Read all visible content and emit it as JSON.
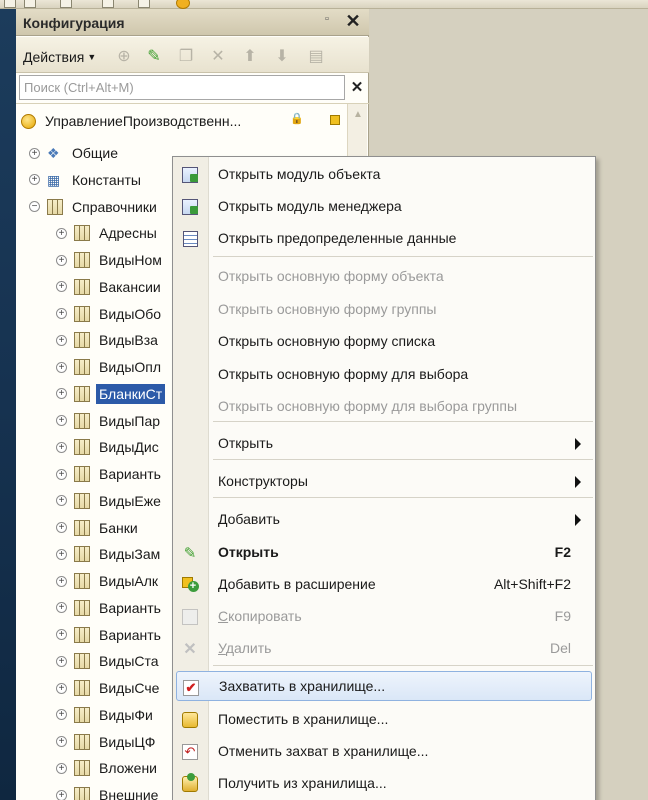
{
  "panel": {
    "title": "Конфигурация",
    "actions_label": "Действия",
    "search_placeholder": "Поиск (Ctrl+Alt+M)"
  },
  "tree": {
    "root": "УправлениеПроизводственн...",
    "items": [
      {
        "label": "Общие",
        "icon": "common-objects-icon",
        "level": 1,
        "expander": "+"
      },
      {
        "label": "Константы",
        "icon": "constants-icon",
        "level": 1,
        "expander": "+"
      },
      {
        "label": "Справочники",
        "icon": "catalog-table-icon",
        "level": 1,
        "expander": "−"
      },
      {
        "label": "Адресны",
        "icon": "catalog-table-icon",
        "level": 2,
        "expander": "+"
      },
      {
        "label": "ВидыНом",
        "icon": "catalog-table-icon",
        "level": 2,
        "expander": "+"
      },
      {
        "label": "Вакансии",
        "icon": "catalog-table-icon",
        "level": 2,
        "expander": "+"
      },
      {
        "label": "ВидыОбо",
        "icon": "catalog-table-icon",
        "level": 2,
        "expander": "+"
      },
      {
        "label": "ВидыВза",
        "icon": "catalog-table-icon",
        "level": 2,
        "expander": "+"
      },
      {
        "label": "ВидыОпл",
        "icon": "catalog-table-icon",
        "level": 2,
        "expander": "+"
      },
      {
        "label": "БланкиСт",
        "icon": "catalog-table-icon",
        "level": 2,
        "expander": "+",
        "selected": true
      },
      {
        "label": "ВидыПар",
        "icon": "catalog-table-icon",
        "level": 2,
        "expander": "+"
      },
      {
        "label": "ВидыДис",
        "icon": "catalog-table-icon",
        "level": 2,
        "expander": "+"
      },
      {
        "label": "Варианть",
        "icon": "catalog-table-icon",
        "level": 2,
        "expander": "+"
      },
      {
        "label": "ВидыЕже",
        "icon": "catalog-table-icon",
        "level": 2,
        "expander": "+"
      },
      {
        "label": "Банки",
        "icon": "catalog-table-icon",
        "level": 2,
        "expander": "+"
      },
      {
        "label": "ВидыЗам",
        "icon": "catalog-table-icon",
        "level": 2,
        "expander": "+"
      },
      {
        "label": "ВидыАлк",
        "icon": "catalog-table-icon",
        "level": 2,
        "expander": "+"
      },
      {
        "label": "Варианть",
        "icon": "catalog-table-icon",
        "level": 2,
        "expander": "+"
      },
      {
        "label": "Варианть",
        "icon": "catalog-table-icon",
        "level": 2,
        "expander": "+"
      },
      {
        "label": "ВидыСта",
        "icon": "catalog-table-icon",
        "level": 2,
        "expander": "+"
      },
      {
        "label": "ВидыСче",
        "icon": "catalog-table-icon",
        "level": 2,
        "expander": "+"
      },
      {
        "label": "ВидыФи",
        "icon": "catalog-table-icon",
        "level": 2,
        "expander": "+"
      },
      {
        "label": "ВидыЦФ",
        "icon": "catalog-table-icon",
        "level": 2,
        "expander": "+"
      },
      {
        "label": "Вложени",
        "icon": "catalog-table-icon",
        "level": 2,
        "expander": "+"
      },
      {
        "label": "Внешние",
        "icon": "catalog-table-icon",
        "level": 2,
        "expander": "+"
      }
    ]
  },
  "menu": {
    "items": [
      {
        "label": "Открыть модуль объекта",
        "icon": "module-icon",
        "enabled": true
      },
      {
        "label": "Открыть модуль менеджера",
        "icon": "module-icon",
        "enabled": true
      },
      {
        "label": "Открыть предопределенные данные",
        "icon": "predefined-data-icon",
        "enabled": true
      },
      {
        "label": "Открыть основную форму объекта",
        "enabled": false
      },
      {
        "label": "Открыть основную форму группы",
        "enabled": false
      },
      {
        "label": "Открыть основную форму списка",
        "enabled": true
      },
      {
        "label": "Открыть основную форму для выбора",
        "enabled": true
      },
      {
        "label": "Открыть основную форму для выбора группы",
        "enabled": false
      },
      {
        "label": "Открыть",
        "enabled": true,
        "submenu": true
      },
      {
        "label": "Конструкторы",
        "enabled": true,
        "submenu": true
      },
      {
        "label": "Добавить",
        "enabled": true,
        "submenu": true
      },
      {
        "label": "Открыть",
        "icon": "pencil-icon",
        "shortcut": "F2",
        "enabled": true,
        "bold": true
      },
      {
        "label": "Добавить в расширение",
        "icon": "add-to-extension-icon",
        "shortcut": "Alt+Shift+F2",
        "enabled": true
      },
      {
        "label": "Скопировать",
        "icon": "copy-icon",
        "shortcut": "F9",
        "enabled": false
      },
      {
        "label": "Удалить",
        "icon": "delete-icon",
        "shortcut": "Del",
        "enabled": false
      },
      {
        "label": "Захватить в хранилище...",
        "icon": "lock-in-storage-icon",
        "enabled": true,
        "highlighted": true
      },
      {
        "label": "Поместить в хранилище...",
        "icon": "put-to-storage-icon",
        "enabled": true
      },
      {
        "label": "Отменить захват в хранилище...",
        "icon": "undo-capture-icon",
        "enabled": true
      },
      {
        "label": "Получить из хранилища...",
        "icon": "get-from-storage-icon",
        "enabled": true
      }
    ]
  }
}
